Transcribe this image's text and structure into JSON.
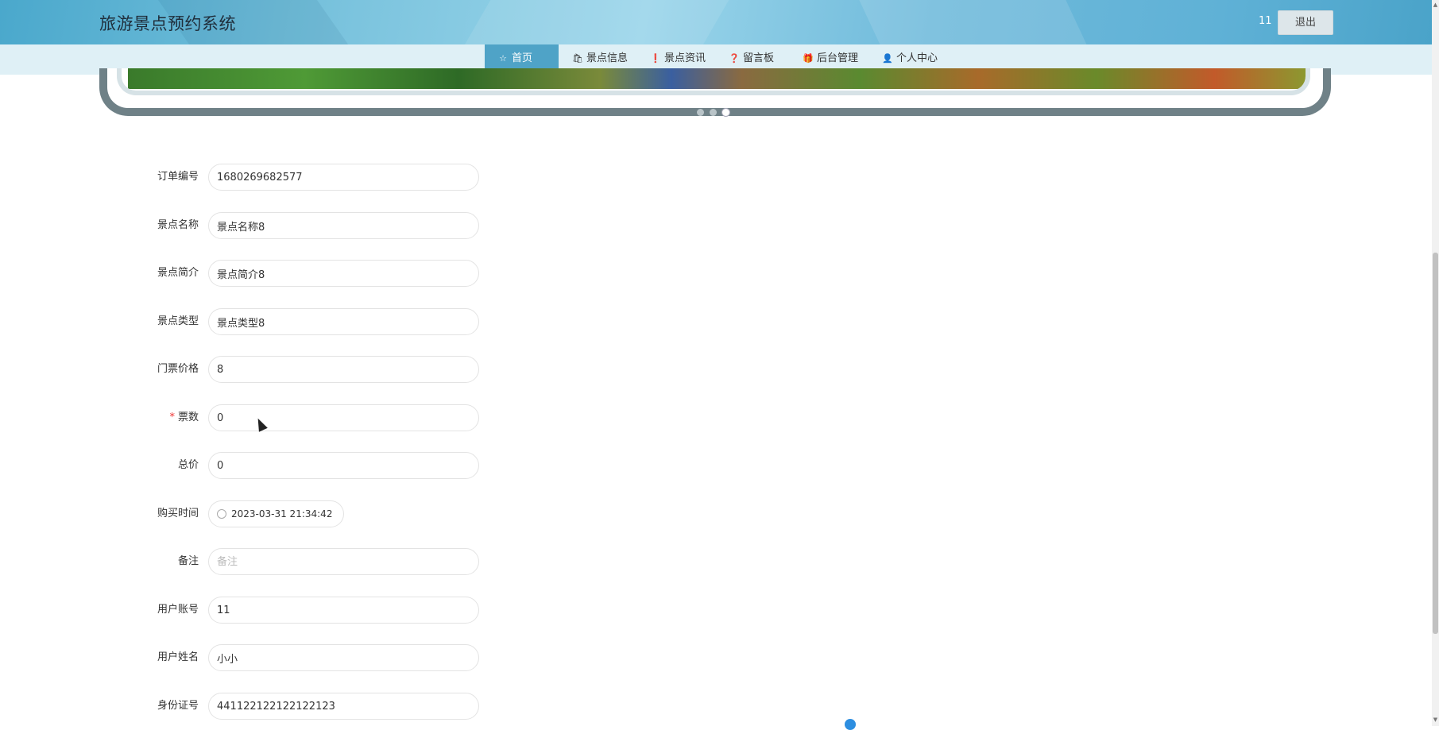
{
  "header": {
    "title": "旅游景点预约系统",
    "username": "11",
    "logout_label": "退出"
  },
  "nav": [
    {
      "label": "首页",
      "icon": "star-icon",
      "active": true
    },
    {
      "label": "景点信息",
      "icon": "bag-icon",
      "active": false
    },
    {
      "label": "景点资讯",
      "icon": "info-icon",
      "active": false
    },
    {
      "label": "留言板",
      "icon": "question-icon",
      "active": false
    },
    {
      "label": "后台管理",
      "icon": "gift-icon",
      "active": false
    },
    {
      "label": "个人中心",
      "icon": "user-icon",
      "active": false
    }
  ],
  "carousel": {
    "slide_count": 3,
    "active_index": 2
  },
  "form": {
    "order_no": {
      "label": "订单编号",
      "value": "1680269682577"
    },
    "scenic_name": {
      "label": "景点名称",
      "value": "景点名称8"
    },
    "scenic_intro": {
      "label": "景点简介",
      "value": "景点简介8"
    },
    "scenic_type": {
      "label": "景点类型",
      "value": "景点类型8"
    },
    "ticket_price": {
      "label": "门票价格",
      "value": "8"
    },
    "ticket_count": {
      "label": "票数",
      "value": "0",
      "required": true,
      "required_mark": "*"
    },
    "total_price": {
      "label": "总价",
      "value": "0"
    },
    "purchase_time": {
      "label": "购买时间",
      "value": "2023-03-31 21:34:42"
    },
    "remark": {
      "label": "备注",
      "value": "",
      "placeholder": "备注"
    },
    "user_account": {
      "label": "用户账号",
      "value": "11"
    },
    "user_name": {
      "label": "用户姓名",
      "value": "小小"
    },
    "id_number": {
      "label": "身份证号",
      "value": "441122122122122123"
    }
  }
}
